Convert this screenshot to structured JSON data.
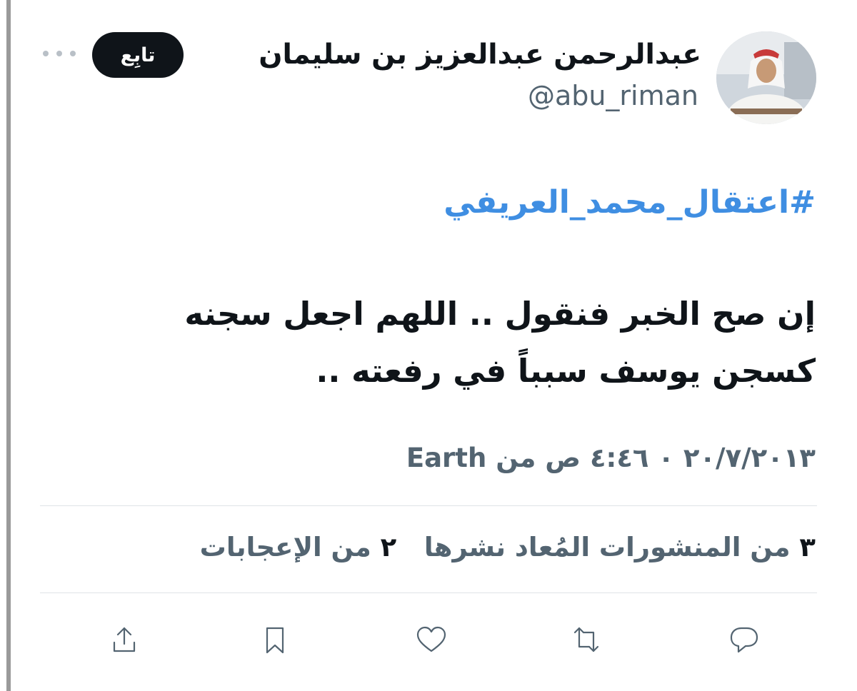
{
  "user": {
    "display_name": "عبدالرحمن عبدالعزيز بن سليمان",
    "handle": "@abu_riman",
    "avatar_icon": "profile-photo"
  },
  "header": {
    "follow_label": "تابِع",
    "more_icon": "more-dots-icon"
  },
  "tweet": {
    "hashtag": "#اعتقال_محمد_العريفي",
    "body": "إن صح الخبر فنقول .. اللهم اجعل سجنه كسجن يوسف سبباً في رفعته ..",
    "timestamp": "٢٠/٧/٢٠١٣ ٠ ٤:٤٦ ص من Earth"
  },
  "stats": {
    "retweets_count": "٣",
    "retweets_label": "من المنشورات المُعاد نشرها",
    "likes_count": "٢",
    "likes_label": "من الإعجابات"
  },
  "actions": [
    "reply-icon",
    "retweet-icon",
    "like-icon",
    "bookmark-icon",
    "share-icon"
  ],
  "colors": {
    "hashtag": "#3f8ee2",
    "muted": "#536471",
    "text": "#0f1419",
    "button_bg": "#0f1419"
  }
}
